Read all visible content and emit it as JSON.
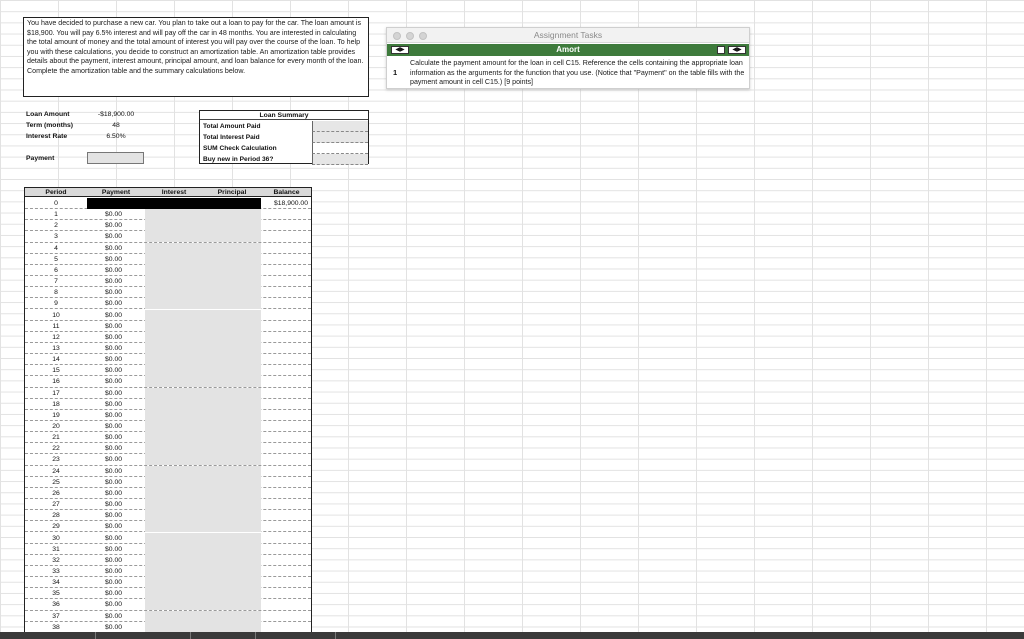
{
  "instructions": {
    "text": "You have decided to purchase a new car. You plan to take out a loan to pay for the car. The loan amount is $18,900. You will pay 6.5% interest and will pay off the car in 48 months. You are interested in calculating the total amount of money and the total amount of interest you will pay over the course of the loan. To help you with these calculations, you decide to construct an amortization table. An amortization table provides details about the payment, interest amount, principal amount, and loan balance for every month of the loan. Complete the amortization table and the summary calculations below."
  },
  "inputs": {
    "loan_amount_label": "Loan Amount",
    "loan_amount_value": "-$18,900.00",
    "term_label": "Term (months)",
    "term_value": "48",
    "rate_label": "Interest Rate",
    "rate_value": "6.50%",
    "payment_label": "Payment"
  },
  "summary": {
    "title": "Loan Summary",
    "rows": [
      "Total Amount Paid",
      "Total Interest Paid",
      "SUM Check Calculation",
      "Buy new in Period 36?"
    ]
  },
  "table": {
    "headers": [
      "Period",
      "Payment",
      "Interest",
      "Principal",
      "Balance"
    ],
    "initial_balance": "$18,900.00",
    "payment_value": "$0.00",
    "periods": [
      "0",
      "1",
      "2",
      "3",
      "4",
      "5",
      "6",
      "7",
      "8",
      "9",
      "10",
      "11",
      "12",
      "13",
      "14",
      "15",
      "16",
      "17",
      "18",
      "19",
      "20",
      "21",
      "22",
      "23",
      "24",
      "25",
      "26",
      "27",
      "28",
      "29",
      "30",
      "31",
      "32",
      "33",
      "34",
      "35",
      "36",
      "37",
      "38"
    ]
  },
  "tasks_window": {
    "title": "Assignment Tasks",
    "tab_label": "Amort",
    "task_number": "1",
    "task_text": "Calculate the payment amount for the loan in cell C15. Reference the cells containing the appropriate loan information as the arguments for the function that you use. (Notice that \"Payment\" on the table fills with the payment amount in cell C15.) [9 points]",
    "prev_glyph": "◀",
    "next_glyph": "▶"
  },
  "colors": {
    "tab_green": "#3e7b3c",
    "shade_gray": "#e3e3e3"
  }
}
